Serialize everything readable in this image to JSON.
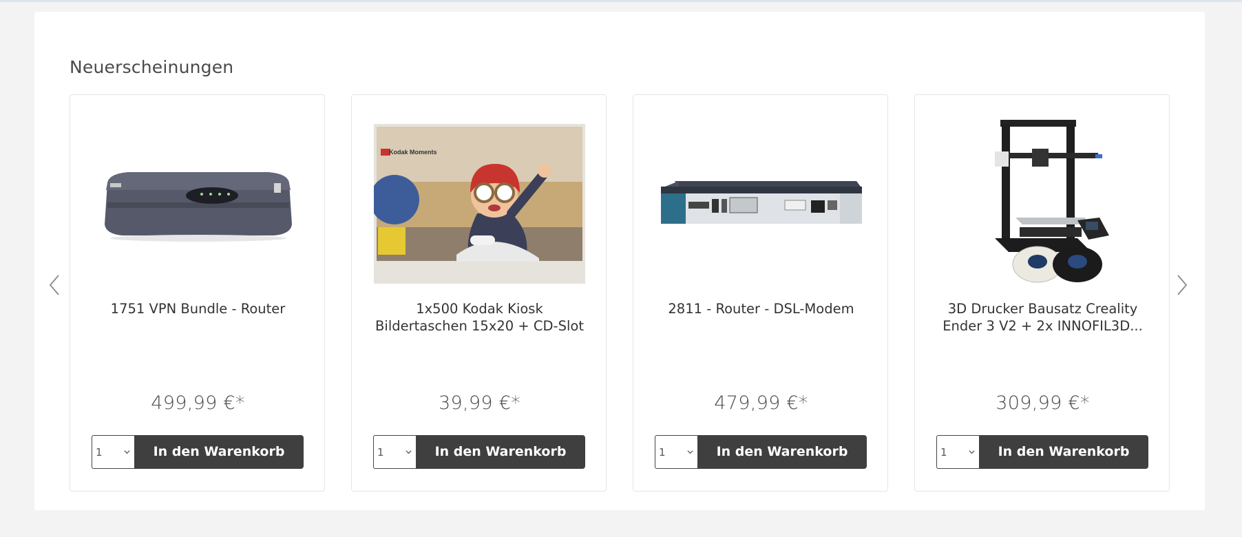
{
  "section": {
    "title": "Neuerscheinungen"
  },
  "carousel": {
    "prev_icon": "chevron-left-icon",
    "next_icon": "chevron-right-icon"
  },
  "products": [
    {
      "name": "1751 VPN Bundle - Router",
      "price": "499,99 €*",
      "quantity": "1",
      "button_label": "In den Warenkorb",
      "image": "cisco-1751-router-image"
    },
    {
      "name": "1x500 Kodak Kiosk Bildertaschen 15x20 + CD-Slot",
      "price": "39,99 €*",
      "quantity": "1",
      "button_label": "In den Warenkorb",
      "image": "kodak-moments-photo-envelope-image",
      "image_text": "Kodak Moments"
    },
    {
      "name": "2811 - Router - DSL-Modem",
      "price": "479,99 €*",
      "quantity": "1",
      "button_label": "In den Warenkorb",
      "image": "cisco-2811-rack-router-image"
    },
    {
      "name": "3D Drucker Bausatz Creality Ender 3 V2 + 2x INNOFIL3D...",
      "price": "309,99 €*",
      "quantity": "1",
      "button_label": "In den Warenkorb",
      "image": "creality-ender-3d-printer-image"
    }
  ],
  "colors": {
    "button_bg": "#3f3f3f",
    "page_bg": "#f3f3f3",
    "panel_bg": "#ffffff"
  }
}
